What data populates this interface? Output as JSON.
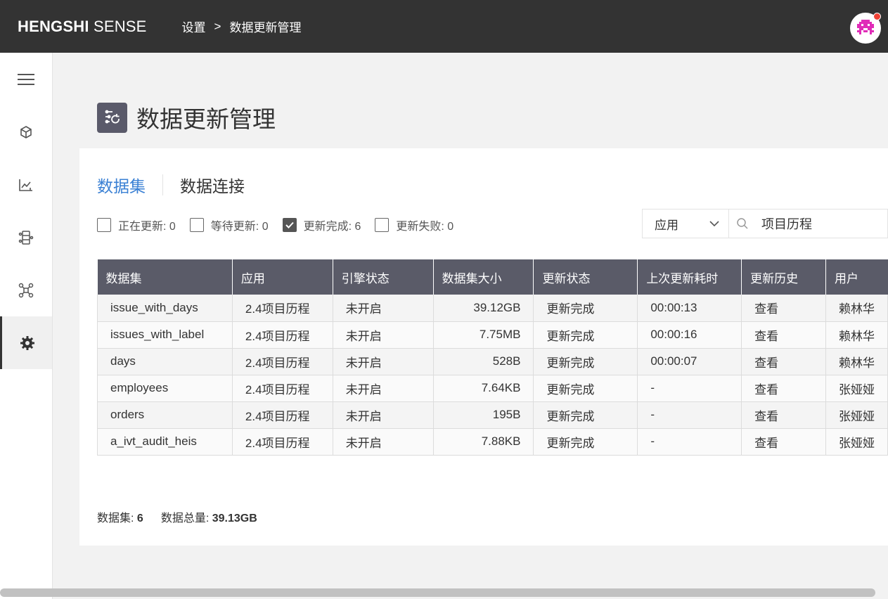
{
  "app": {
    "logo_bold": "HENGSHI",
    "logo_light": " SENSE",
    "breadcrumb": [
      "设置",
      "数据更新管理"
    ],
    "breadcrumb_sep": ">"
  },
  "sidebar": {
    "items": [
      {
        "icon": "menu-icon"
      },
      {
        "icon": "cube-icon"
      },
      {
        "icon": "chart-icon"
      },
      {
        "icon": "dataflow-icon"
      },
      {
        "icon": "network-icon"
      },
      {
        "icon": "gear-icon",
        "active": true
      }
    ]
  },
  "page": {
    "title": "数据更新管理"
  },
  "tabs": [
    {
      "label": "数据集",
      "active": true
    },
    {
      "label": "数据连接",
      "active": false
    }
  ],
  "filters": [
    {
      "label": "正在更新: 0",
      "checked": false
    },
    {
      "label": "等待更新: 0",
      "checked": false
    },
    {
      "label": "更新完成: 6",
      "checked": true
    },
    {
      "label": "更新失败: 0",
      "checked": false
    }
  ],
  "app_select": {
    "value": "应用"
  },
  "search": {
    "value": "项目历程"
  },
  "table": {
    "headers": [
      "数据集",
      "应用",
      "引擎状态",
      "数据集大小",
      "更新状态",
      "上次更新耗时",
      "更新历史",
      "用户"
    ],
    "rows": [
      [
        "issue_with_days",
        "2.4项目历程",
        "未开启",
        "39.12GB",
        "更新完成",
        "00:00:13",
        "查看",
        "赖林华"
      ],
      [
        "issues_with_label",
        "2.4项目历程",
        "未开启",
        "7.75MB",
        "更新完成",
        "00:00:16",
        "查看",
        "赖林华"
      ],
      [
        "days",
        "2.4项目历程",
        "未开启",
        "528B",
        "更新完成",
        "00:00:07",
        "查看",
        "赖林华"
      ],
      [
        "employees",
        "2.4项目历程",
        "未开启",
        "7.64KB",
        "更新完成",
        "-",
        "查看",
        "张娅娅"
      ],
      [
        "orders",
        "2.4项目历程",
        "未开启",
        "195B",
        "更新完成",
        "-",
        "查看",
        "张娅娅"
      ],
      [
        "a_ivt_audit_heis",
        "2.4项目历程",
        "未开启",
        "7.88KB",
        "更新完成",
        "-",
        "查看",
        "张娅娅"
      ]
    ]
  },
  "summary": {
    "datasets_label": "数据集:",
    "datasets_value": "6",
    "total_label": "数据总量:",
    "total_value": "39.13GB"
  },
  "colors": {
    "topbar": "#333333",
    "accent": "#3a80d4",
    "table_header": "#5a5b68",
    "notification": "#f04134",
    "avatar": "#e02cb8"
  }
}
